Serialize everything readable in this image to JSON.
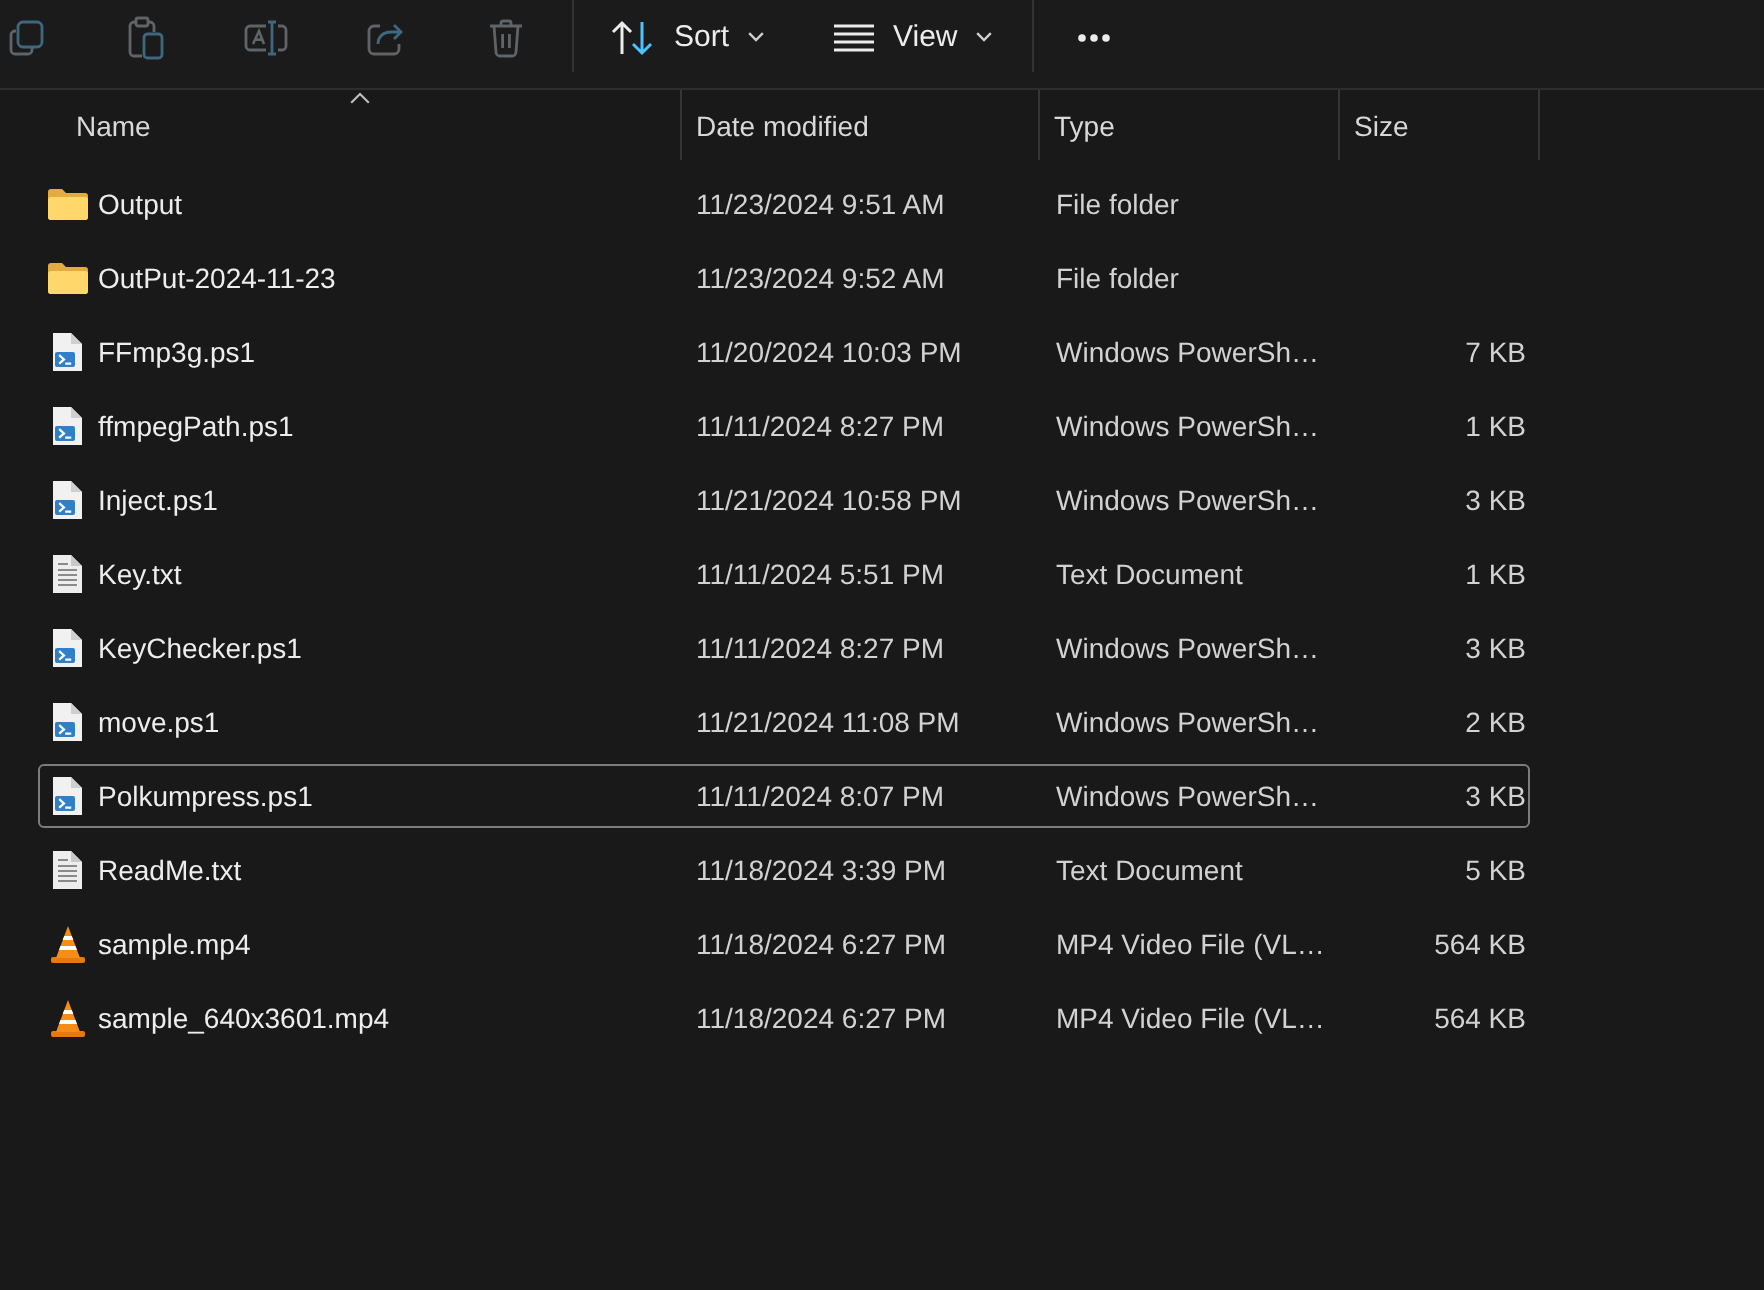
{
  "toolbar": {
    "groups": [
      [
        {
          "kind": "copy",
          "disabled": true
        },
        {
          "kind": "paste",
          "disabled": true
        },
        {
          "kind": "rename",
          "disabled": true
        },
        {
          "kind": "share",
          "disabled": true
        },
        {
          "kind": "delete",
          "disabled": true
        }
      ],
      [
        {
          "kind": "sort",
          "label": "Sort",
          "disabled": false
        },
        {
          "kind": "view",
          "label": "View",
          "disabled": false
        }
      ],
      [
        {
          "kind": "more",
          "disabled": false
        }
      ]
    ]
  },
  "columns": [
    {
      "label": "Name",
      "sorted": true
    },
    {
      "label": "Date modified",
      "sorted": false
    },
    {
      "label": "Type",
      "sorted": false
    },
    {
      "label": "Size",
      "sorted": false
    }
  ],
  "rows": [
    {
      "name": "Output",
      "kind": "folder",
      "date": "11/23/2024 9:51 AM",
      "type": "File folder",
      "focused": false
    },
    {
      "name": "OutPut-2024-11-23",
      "kind": "folder",
      "date": "11/23/2024 9:52 AM",
      "type": "File folder",
      "focused": false
    },
    {
      "name": "FFmp3g.ps1",
      "kind": "script",
      "date": "11/20/2024 10:03 PM",
      "type": "Windows PowerSh…",
      "size": "7 KB",
      "focused": false
    },
    {
      "name": "ffmpegPath.ps1",
      "kind": "script",
      "date": "11/11/2024 8:27 PM",
      "type": "Windows PowerSh…",
      "size": "1 KB",
      "focused": false
    },
    {
      "name": "Inject.ps1",
      "kind": "script",
      "date": "11/21/2024 10:58 PM",
      "type": "Windows PowerSh…",
      "size": "3 KB",
      "focused": false
    },
    {
      "name": "Key.txt",
      "kind": "text",
      "date": "11/11/2024 5:51 PM",
      "type": "Text Document",
      "size": "1 KB",
      "focused": false
    },
    {
      "name": "KeyChecker.ps1",
      "kind": "script",
      "date": "11/11/2024 8:27 PM",
      "type": "Windows PowerSh…",
      "size": "3 KB",
      "focused": false
    },
    {
      "name": "move.ps1",
      "kind": "script",
      "date": "11/21/2024 11:08 PM",
      "type": "Windows PowerSh…",
      "size": "2 KB",
      "focused": false
    },
    {
      "name": "Polkumpress.ps1",
      "kind": "script",
      "date": "11/11/2024 8:07 PM",
      "type": "Windows PowerSh…",
      "size": "3 KB",
      "focused": true
    },
    {
      "name": "ReadMe.txt",
      "kind": "text",
      "date": "11/18/2024 3:39 PM",
      "type": "Text Document",
      "size": "5 KB",
      "focused": false
    },
    {
      "name": "sample.mp4",
      "kind": "video",
      "date": "11/18/2024 6:27 PM",
      "type": "MP4 Video File (VL…",
      "size": "564 KB",
      "focused": false
    },
    {
      "name": "sample_640x3601.mp4",
      "kind": "video",
      "date": "11/18/2024 6:27 PM",
      "type": "MP4 Video File (VL…",
      "size": "564 KB",
      "focused": false
    }
  ]
}
